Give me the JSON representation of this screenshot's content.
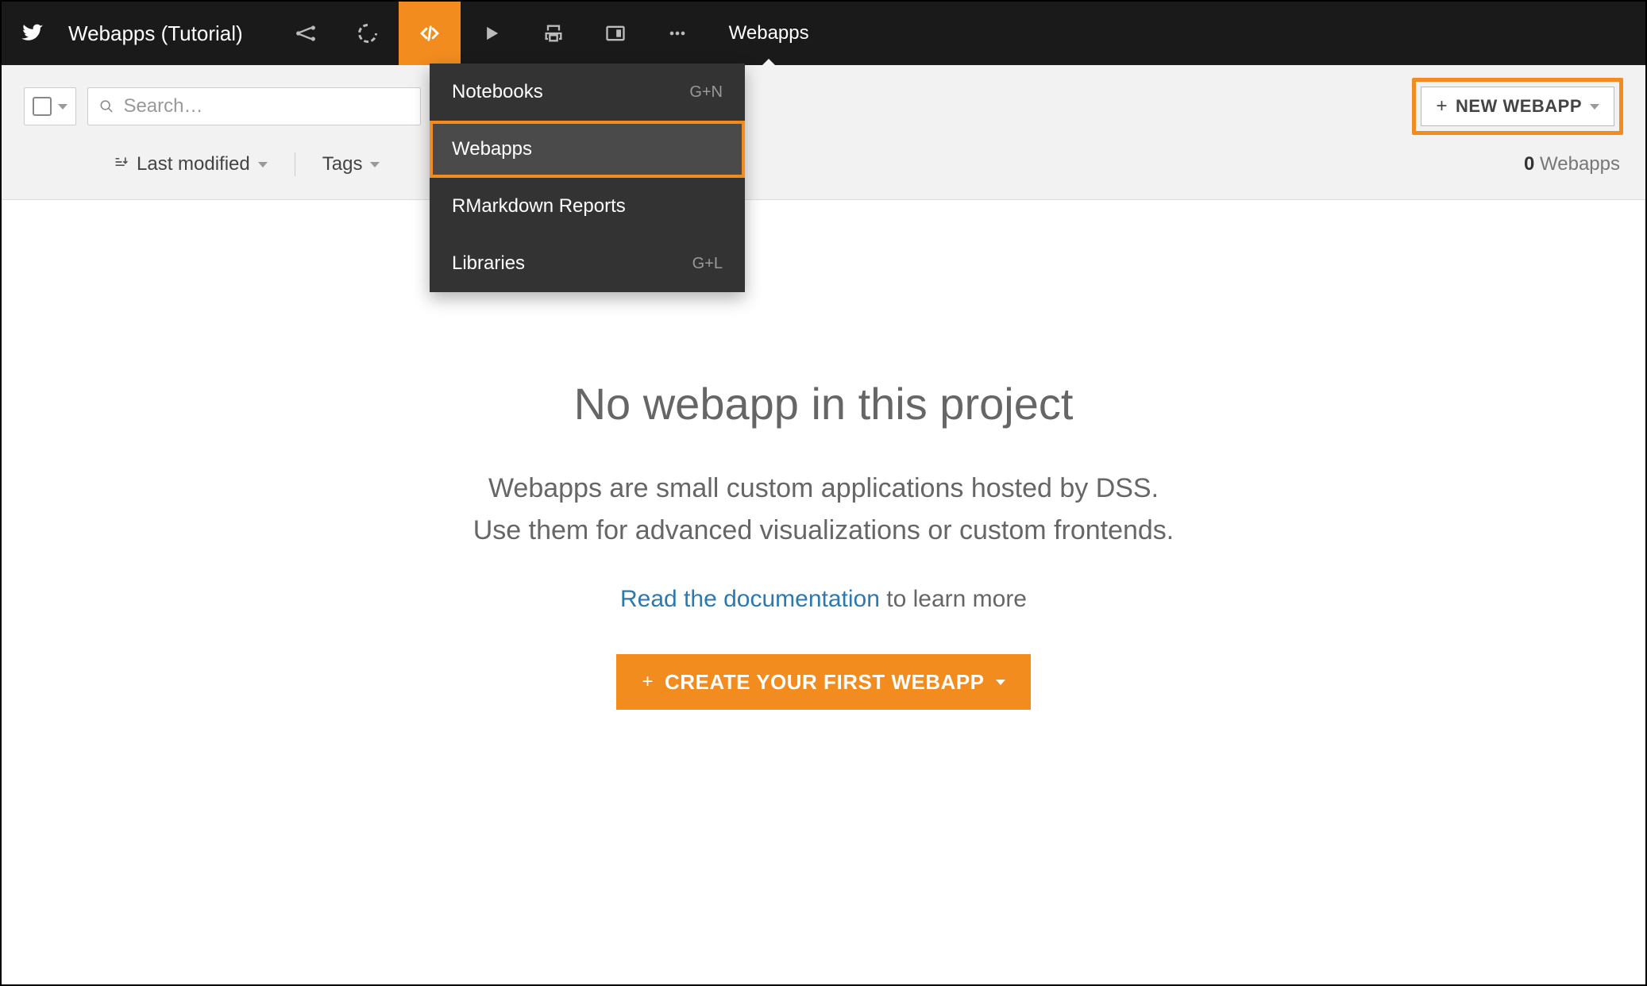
{
  "topbar": {
    "project_title": "Webapps (Tutorial)",
    "section_label": "Webapps"
  },
  "dropdown": {
    "items": [
      {
        "label": "Notebooks",
        "shortcut": "G+N"
      },
      {
        "label": "Webapps",
        "shortcut": ""
      },
      {
        "label": "RMarkdown Reports",
        "shortcut": ""
      },
      {
        "label": "Libraries",
        "shortcut": "G+L"
      }
    ]
  },
  "filterbar": {
    "search_placeholder": "Search…",
    "new_button_label": "NEW WEBAPP",
    "sort_label": "Last modified",
    "tags_label": "Tags",
    "count_number": "0",
    "count_noun": "Webapps"
  },
  "empty": {
    "heading": "No webapp in this project",
    "desc_line1": "Webapps are small custom applications hosted by DSS.",
    "desc_line2": "Use them for advanced visualizations or custom frontends.",
    "doc_link_text": "Read the documentation",
    "doc_suffix": " to learn more",
    "create_button_label": "CREATE YOUR FIRST WEBAPP"
  }
}
